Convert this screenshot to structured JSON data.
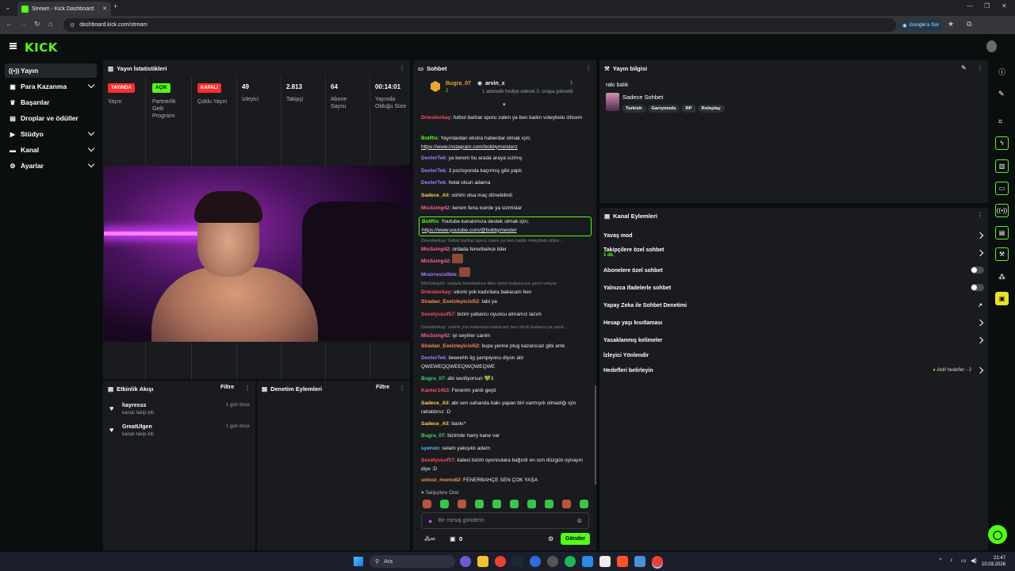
{
  "browser": {
    "tab_title": "Stream - Kick Dashboard",
    "url": "dashboard.kick.com/stream",
    "google_ask": "Google'a Sor"
  },
  "header": {
    "logo": "KICK"
  },
  "sidebar": {
    "items": [
      {
        "label": "Yayın",
        "icon": "broadcast-icon"
      },
      {
        "label": "Para Kazanma",
        "icon": "money-icon"
      },
      {
        "label": "Başarılar",
        "icon": "trophy-icon"
      },
      {
        "label": "Droplar ve ödüller",
        "icon": "gift-icon"
      },
      {
        "label": "Stüdyo",
        "icon": "studio-icon"
      },
      {
        "label": "Kanal",
        "icon": "channel-icon"
      },
      {
        "label": "Ayarlar",
        "icon": "gear-icon"
      }
    ]
  },
  "stats": {
    "title": "Yayın İstatistikleri",
    "items": [
      {
        "badge": "YAYINDA",
        "label": "Yayın"
      },
      {
        "badge": "AÇIK",
        "label": "Partnerlik Gelir Programı"
      },
      {
        "badge": "KAPALI",
        "label": "Çoklu Yayın"
      },
      {
        "value": "49",
        "label": "İzleyici"
      },
      {
        "value": "2.813",
        "label": "Takipçi"
      },
      {
        "value": "64",
        "label": "Abone Sayısı"
      },
      {
        "value": "00:14:01",
        "label": "Yayında Olduğu Süre"
      }
    ]
  },
  "activity": {
    "title": "Etkinlik Akışı",
    "filter": "Filtre",
    "items": [
      {
        "name": "hayresss",
        "desc": "kanalı takip etti",
        "time": "1 gün önce"
      },
      {
        "name": "GreatUlgen",
        "desc": "kanalı takip etti",
        "time": "1 gün önce"
      }
    ]
  },
  "moderation": {
    "title": "Denetim Eylemleri",
    "filter": "Filtre"
  },
  "chat": {
    "title": "Sohbet",
    "pinned": {
      "user1": "Bugra_07",
      "user1_count": "2",
      "user2": "arvin_x",
      "user2_count": "1",
      "text": "1 abonelik hediye ederek 3. sıraya yükseldi"
    },
    "messages": [
      {
        "user": "Driesberkay",
        "text": "futbol barbar sporu zaten ya ben kadın voleybolu izlicem",
        "color": "#ff4d5e"
      },
      {
        "user": "BotRix",
        "text": "Yayınlardan ekstra haberdar olmak için;",
        "link": "https://www.instagram.com/bobbymeisterz",
        "color": "#53fc18"
      },
      {
        "user": "DexterTek",
        "text": "ya kerem bu arada araya sızmış",
        "color": "#a97cff"
      },
      {
        "user": "DexterTek",
        "text": "3 pozisyonda kaçırmış gibi yaptı",
        "color": "#a97cff"
      },
      {
        "user": "DexterTek",
        "text": "helal olsun adama",
        "color": "#a97cff"
      },
      {
        "user": "Sadece_Ali",
        "text": "oshim olsa maç dönebilirdi",
        "color": "#ffd04d"
      },
      {
        "user": "MisSsing42",
        "text": "kerem fena icerde ya sizmislar",
        "color": "#ff5fa0"
      },
      {
        "user": "BotRix",
        "text": "Youtube kanalımıza destek olmak için;",
        "link": "https://www.youtube.com/@bobbymeister",
        "color": "#53fc18"
      },
      {
        "reply": "Driesberkay: futbol barbar sporu zaten ya ben kadın voleybolu izlice...",
        "user": "MisSsing42",
        "text": "ordada fenerbahce lider",
        "color": "#ff5fa0"
      },
      {
        "user": "MisSsing42",
        "text": "",
        "color": "#ff5fa0"
      },
      {
        "user": "Mrsirresistible",
        "text": "",
        "color": "#a97cff"
      },
      {
        "reply": "MisSsing42: ordada fenerbahce lider isimli kullanıcıya yanıt veriyor",
        "user": "Driesberkay",
        "text": "sıkıntı yok kadınlara bakacam ben",
        "color": "#ff4d5e"
      },
      {
        "user": "Siradan_Exelzleyicisi52",
        "text": "tabi ya",
        "color": "#ff8a4d"
      },
      {
        "user": "Sesetyusuf57",
        "text": "bizim yabancı oyuncu almamız lazım",
        "color": "#ff4d5e"
      },
      {
        "reply": "Driesberkay: sıkıntı yok kadınlara bakacam ben isimli kullanıcıya yanıt...",
        "user": "MisSsing42",
        "text": "iyi seyirler canim",
        "color": "#ff5fa0"
      },
      {
        "user": "Siradan_Exelzleyicisi52",
        "text": "kupa yerine plug kazanıcaz gibi amk",
        "color": "#ff8a4d"
      },
      {
        "user": "DexterTek",
        "text": "tieeeehh lig şampiyonu diyon abi QWEWEQQWEEQWQWEQWE",
        "color": "#a97cff"
      },
      {
        "user": "Bugra_07",
        "text": "abi seviliyorsun 💚3",
        "color": "#3cd16b"
      },
      {
        "user": "Kanter1453",
        "text": "Fenerim yardı geçti",
        "color": "#ff4d5e"
      },
      {
        "user": "Sadece_Ali",
        "text": "abi sen sahanda bakı yapan biri varmıydı olmadığı için rahatdınız :D",
        "color": "#ffd04d"
      },
      {
        "user": "Sadece_Ali",
        "text": "baskı*",
        "color": "#ffd04d"
      },
      {
        "user": "Bugra_07",
        "text": "bizimde harry kane var",
        "color": "#3cd16b"
      },
      {
        "user": "syenon",
        "text": "selam yakışıklı adam",
        "color": "#5fb7ff"
      },
      {
        "user": "Sesetyusuf57",
        "text": "kaleci bizim oyunculara bağırdı en son düzgün oynayın diye :D",
        "color": "#ff4d5e"
      },
      {
        "user": "unlost_memo82",
        "text": "FENERBAHÇE SEN ÇOK YAŞA",
        "color": "#ff8a4d"
      }
    ],
    "followers_only": "Takipçilere Özel",
    "input_placeholder": "Bir mesaj gönderin",
    "count": "0",
    "send": "Gönder"
  },
  "stream_info": {
    "title": "Yayın bilgisi",
    "stream_title": "rakı balık",
    "category": "Sadece Sohbet",
    "tags": [
      "Turkish",
      "Garrymods",
      "RP",
      "Roleplay"
    ]
  },
  "channel_actions": {
    "title": "Kanal Eylemleri",
    "items": [
      {
        "label": "Yavaş mod",
        "type": "arrow"
      },
      {
        "label": "Takipçilere özel sohbet",
        "sub": "1 dk.",
        "type": "arrow"
      },
      {
        "label": "Abonelere özel sohbet",
        "type": "toggle"
      },
      {
        "label": "Yalnızca ifadelerle sohbet",
        "type": "toggle"
      },
      {
        "label": "Yapay Zeka ile Sohbet Denetimi",
        "type": "external"
      },
      {
        "label": "Hesap yaşı kısıtlaması",
        "type": "arrow"
      },
      {
        "label": "Yasaklanmış kelimeler",
        "type": "arrow"
      },
      {
        "label": "İzleyici Yönlendir",
        "type": "none"
      },
      {
        "label": "Hedefleri belirleyin",
        "type": "arrow",
        "status": "Aktif hedefler - 2"
      }
    ]
  },
  "taskbar": {
    "search": "Ara",
    "time": "21:47",
    "date": "10.03.2026"
  }
}
